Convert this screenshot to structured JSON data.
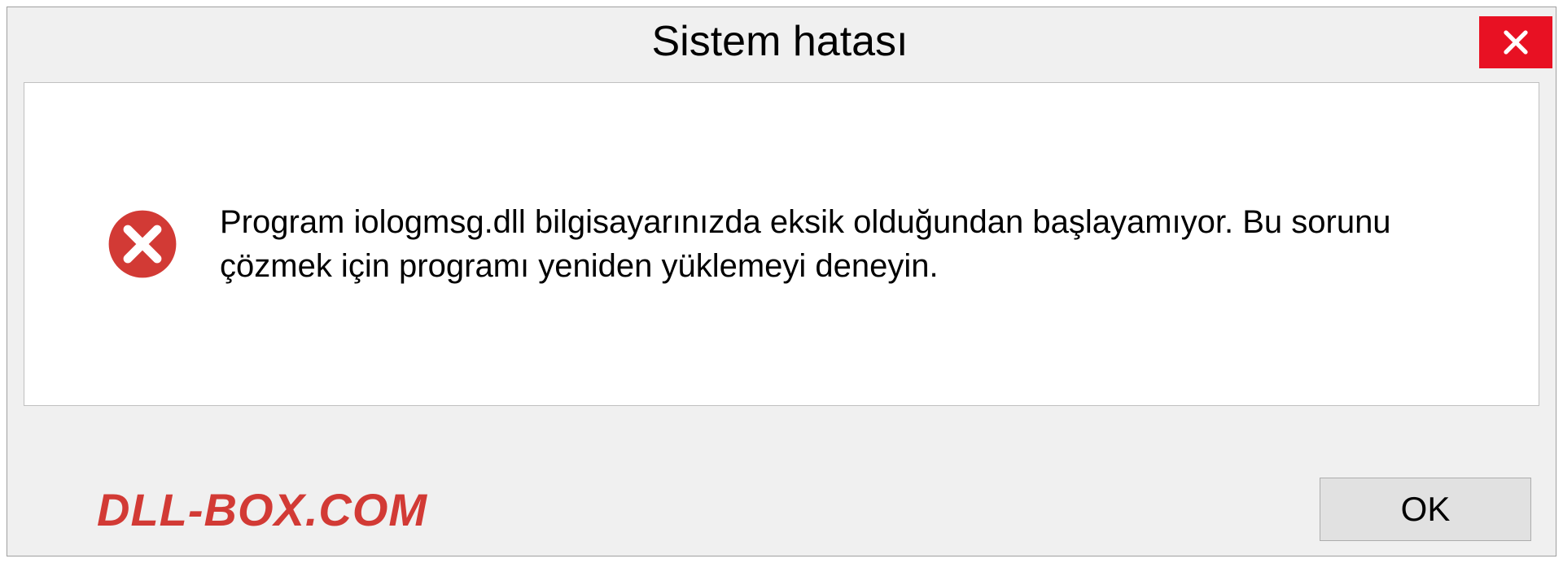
{
  "dialog": {
    "title": "Sistem hatası",
    "message": "Program iologmsg.dll bilgisayarınızda eksik olduğundan başlayamıyor. Bu sorunu çözmek için programı yeniden yüklemeyi deneyin.",
    "ok_label": "OK"
  },
  "watermark": "DLL-BOX.COM",
  "colors": {
    "close_button": "#e81123",
    "error_icon": "#d23a35",
    "watermark": "#d23a35"
  }
}
